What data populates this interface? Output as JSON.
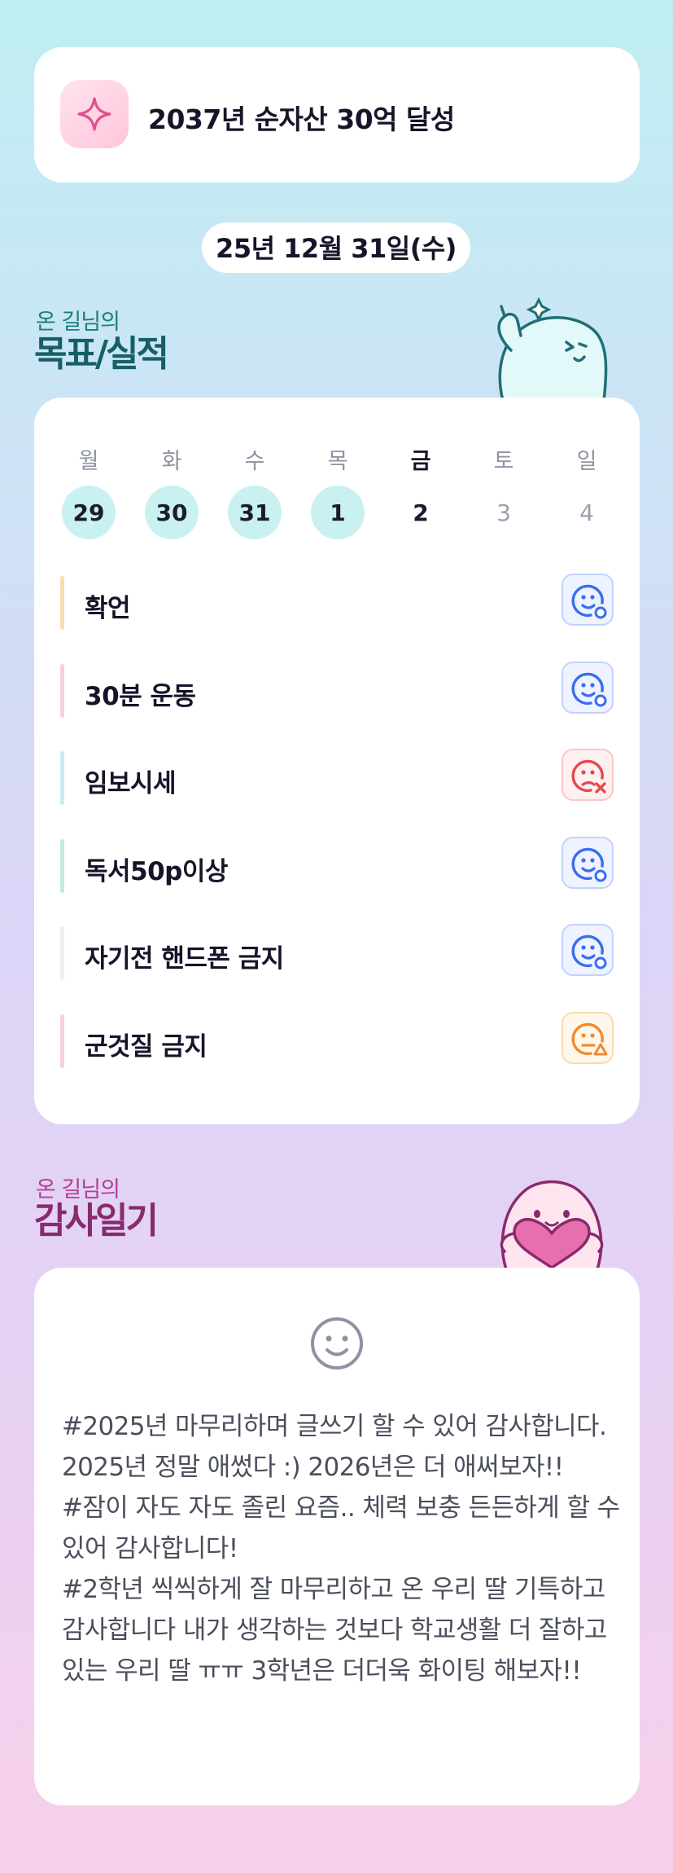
{
  "goal": {
    "text": "2037년 순자산 30억 달성",
    "icon": "sparkle-icon"
  },
  "date": {
    "label": "25년 12월 31일(수)"
  },
  "goals_section": {
    "small": "온 길님의",
    "big": "목표/실적"
  },
  "week": {
    "days": [
      {
        "name": "월",
        "num": "29",
        "state": "done"
      },
      {
        "name": "화",
        "num": "30",
        "state": "done"
      },
      {
        "name": "수",
        "num": "31",
        "state": "done"
      },
      {
        "name": "목",
        "num": "1",
        "state": "done"
      },
      {
        "name": "금",
        "num": "2",
        "state": "today"
      },
      {
        "name": "토",
        "num": "3",
        "state": "future"
      },
      {
        "name": "일",
        "num": "4",
        "state": "future"
      }
    ]
  },
  "habits": [
    {
      "label": "확언",
      "bar_color": "#f7deb0",
      "status": "good"
    },
    {
      "label": "30분 운동",
      "bar_color": "#f9cde3",
      "status": "good"
    },
    {
      "label": "임보시세",
      "bar_color": "#c7eef1",
      "status": "bad"
    },
    {
      "label": "독서50p이상",
      "bar_color": "#c2ecdf",
      "status": "good"
    },
    {
      "label": "자기전 핸드폰 금지",
      "bar_color": "#eeeeef",
      "status": "good"
    },
    {
      "label": "군것질 금지",
      "bar_color": "#f9cde3",
      "status": "warn"
    }
  ],
  "gratitude_section": {
    "small": "온 길님의",
    "big": "감사일기"
  },
  "gratitude": {
    "mood_icon": "smile-icon",
    "text": "#2025년 마무리하며 글쓰기 할 수 있어 감사합니다. 2025년 정말 애썼다 :) 2026년은 더 애써보자!!\n#잠이 자도 자도 졸린 요즘.. 체력 보충 든든하게 할 수 있어 감사합니다!\n#2학년 씩씩하게 잘 마무리하고 온 우리 딸 기특하고 감사합니다 내가 생각하는 것보다 학교생활 더 잘하고 있는 우리 딸 ㅠㅠ 3학년은 더더욱 화이팅 해보자!!"
  },
  "colors": {
    "good": "#3a6df0",
    "bad": "#e5484d",
    "warn": "#ef8b2c",
    "done_day": "#c9f1f2"
  }
}
